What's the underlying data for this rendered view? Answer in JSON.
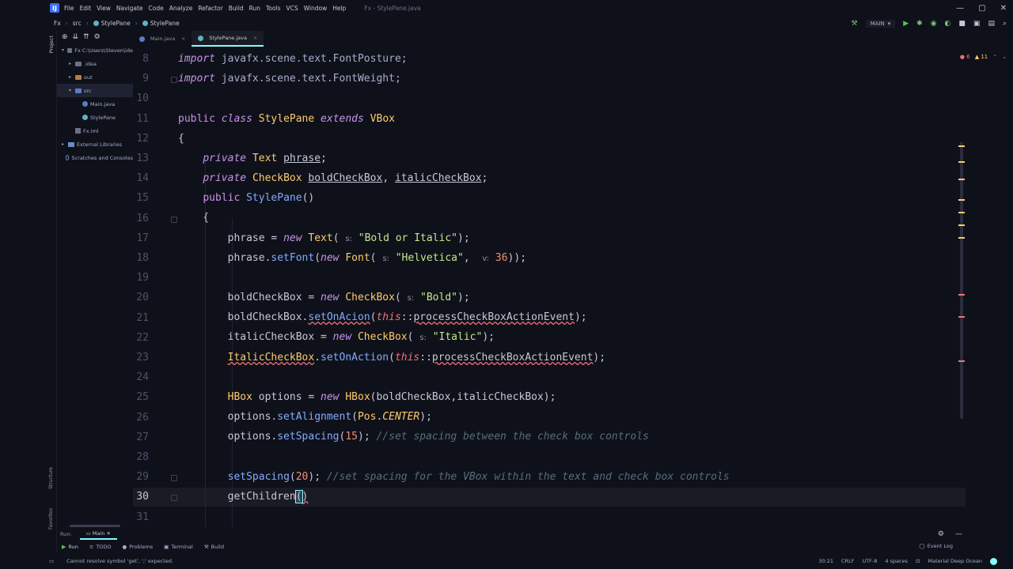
{
  "window": {
    "logo": "IJ",
    "menu": [
      "File",
      "Edit",
      "View",
      "Navigate",
      "Code",
      "Analyze",
      "Refactor",
      "Build",
      "Run",
      "Tools",
      "VCS",
      "Window",
      "Help"
    ],
    "title": "Fx - StylePane.java",
    "controls": [
      "—",
      "▢",
      "✕"
    ]
  },
  "breadcrumb": [
    "Fx",
    "src",
    "StylePane",
    "StylePane"
  ],
  "run_config": {
    "name": "MAIN"
  },
  "project_panel": {
    "tab_label": "Project",
    "items": [
      {
        "label": "Fx  C:\\Users\\Steven\\ide",
        "indent": 0,
        "icon": "folder-grey",
        "arrow": "▾"
      },
      {
        "label": ".idea",
        "indent": 1,
        "icon": "folder-grey",
        "arrow": "▸"
      },
      {
        "label": "out",
        "indent": 1,
        "icon": "folder-orange",
        "arrow": "▸"
      },
      {
        "label": "src",
        "indent": 1,
        "icon": "folder-blue",
        "arrow": "▾"
      },
      {
        "label": "Main.java",
        "indent": 2,
        "icon": "file-java",
        "arrow": ""
      },
      {
        "label": "StylePane",
        "indent": 2,
        "icon": "file-class",
        "arrow": ""
      },
      {
        "label": "Fx.iml",
        "indent": 1,
        "icon": "file-iml",
        "arrow": ""
      },
      {
        "label": "External Libraries",
        "indent": 0,
        "icon": "lib",
        "arrow": "▸"
      },
      {
        "label": "Scratches and Consoles",
        "indent": 0,
        "icon": "scratch",
        "arrow": ""
      }
    ],
    "structure_label": "Structure",
    "favorites_label": "Favorites"
  },
  "tabs": [
    {
      "label": "Main.java",
      "active": false
    },
    {
      "label": "StylePane.java",
      "active": true
    }
  ],
  "inspections": {
    "errors": "6",
    "warnings": "11"
  },
  "editor": {
    "line_numbers": [
      "8",
      "9",
      "10",
      "11",
      "12",
      "13",
      "14",
      "15",
      "16",
      "17",
      "18",
      "19",
      "20",
      "21",
      "22",
      "23",
      "24",
      "25",
      "26",
      "27",
      "28",
      "29",
      "30",
      "31"
    ],
    "current_line": "30"
  },
  "bottom": {
    "run_label": "Run:",
    "main_tab": "Main",
    "tool_windows": [
      "Run",
      "TODO",
      "Problems",
      "Terminal",
      "Build"
    ],
    "event_log": "Event Log"
  },
  "status": {
    "message": "Cannot resolve symbol 'get', ';' expected.",
    "position": "30:21",
    "line_sep": "CRLF",
    "encoding": "UTF-8",
    "indent": "4 spaces",
    "theme": "Material Deep Ocean"
  },
  "colors": {
    "background": "#0f111a",
    "accent": "#84ffff",
    "keyword": "#c792ea",
    "type": "#ffcb6b",
    "string": "#c3e88d",
    "number": "#f78c6c",
    "comment": "#546e7a",
    "error": "#f07178"
  }
}
